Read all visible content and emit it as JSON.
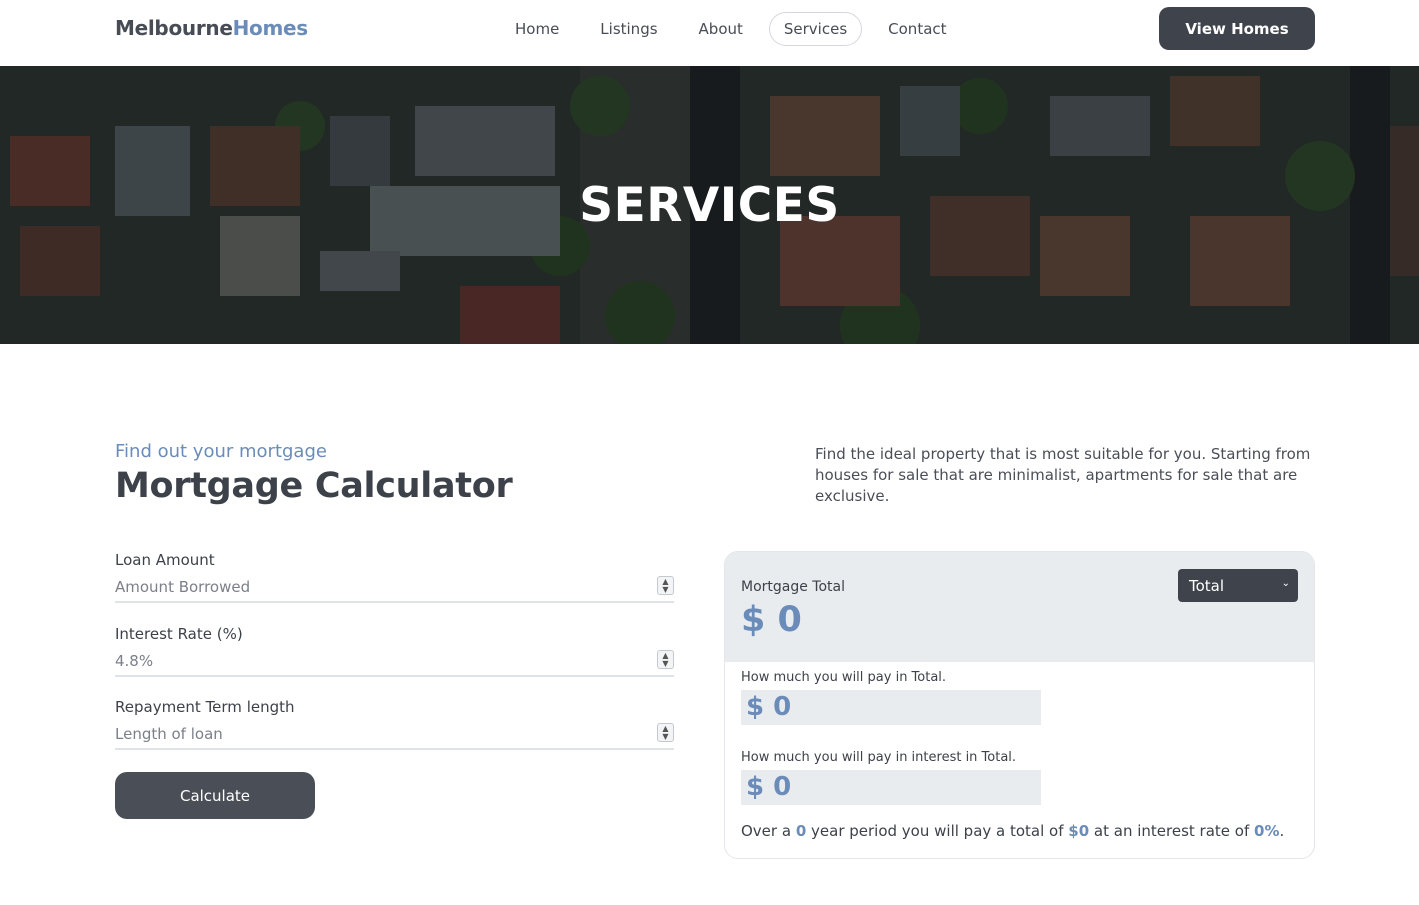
{
  "brand": {
    "part1": "Melbourne",
    "part2": "Homes"
  },
  "nav": {
    "items": [
      {
        "label": "Home"
      },
      {
        "label": "Listings"
      },
      {
        "label": "About"
      },
      {
        "label": "Services",
        "active": true
      },
      {
        "label": "Contact"
      }
    ],
    "cta_label": "View Homes"
  },
  "hero": {
    "title": "SERVICES"
  },
  "intro": {
    "eyebrow": "Find out your mortgage",
    "title": "Mortgage Calculator",
    "description": "Find the ideal property that is most suitable for you. Starting from houses for sale that are minimalist, apartments for sale that are exclusive."
  },
  "form": {
    "loan": {
      "label": "Loan Amount",
      "placeholder": "Amount Borrowed",
      "value": ""
    },
    "rate": {
      "label": "Interest Rate (%)",
      "placeholder": "4.8%",
      "value": ""
    },
    "term": {
      "label": "Repayment Term length",
      "placeholder": "Length of loan",
      "value": ""
    },
    "submit_label": "Calculate"
  },
  "results": {
    "total_label": "Mortgage Total",
    "total_value": "$ 0",
    "mode_select": {
      "selected": "Total"
    },
    "pay_total_label": "How much you will pay in Total.",
    "pay_total_value": "$ 0",
    "pay_interest_label": "How much you will pay in interest in Total.",
    "pay_interest_value": "$ 0",
    "summary": {
      "prefix": "Over a ",
      "years": "0",
      "mid1": " year period you will pay a total of ",
      "total": "$0",
      "mid2": " at an interest rate of ",
      "rate": "0%",
      "suffix": "."
    }
  },
  "colors": {
    "accent": "#6b8cb8",
    "dark_button": "#3f444c",
    "card_bg": "#e9ecef"
  }
}
